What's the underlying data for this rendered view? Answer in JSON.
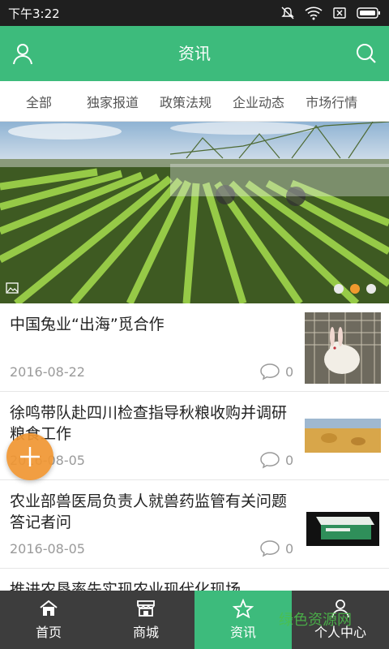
{
  "status_bar": {
    "time": "下午3:22"
  },
  "app_bar": {
    "title": "资讯",
    "left_icon": "user-icon",
    "right_icon": "search-icon"
  },
  "tabs": [
    "全部",
    "独家报道",
    "政策法规",
    "企业动态",
    "市场行情"
  ],
  "banner": {
    "dots": 3,
    "active_dot": 1
  },
  "news": [
    {
      "title": "中国兔业“出海”觅合作",
      "date": "2016-08-22",
      "comments": "0"
    },
    {
      "title": "徐鸣带队赴四川检查指导秋粮收购并调研粮食工作",
      "date": "2016-08-05",
      "comments": "0"
    },
    {
      "title": "农业部兽医局负责人就兽药监管有关问题答记者问",
      "date": "2016-08-05",
      "comments": "0"
    },
    {
      "title": "推进农垦率先实现农业现代化现场",
      "date": "",
      "comments": ""
    }
  ],
  "bottom_nav": [
    {
      "label": "首页",
      "icon": "home-icon"
    },
    {
      "label": "商城",
      "icon": "store-icon"
    },
    {
      "label": "资讯",
      "icon": "star-icon",
      "active": true
    },
    {
      "label": "个人中心",
      "icon": "user-icon"
    }
  ],
  "watermark": "绿色资源网",
  "colors": {
    "primary": "#3dbb7c",
    "nav_bg": "#3d3d3d",
    "fab": "#f0962e"
  }
}
